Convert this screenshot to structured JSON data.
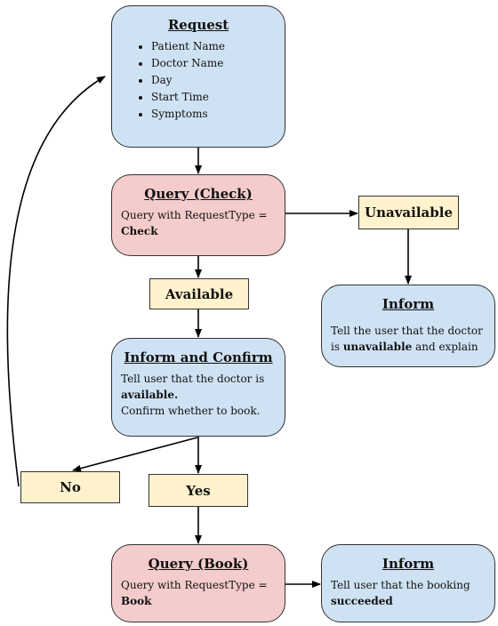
{
  "colors": {
    "process_blue": "#cfe2f3",
    "query_pink": "#f4cccc",
    "label_yellow": "#fff2cc",
    "stroke": "#000000"
  },
  "request": {
    "title": "Request",
    "items": [
      "Patient Name",
      "Doctor Name",
      "Day",
      "Start Time",
      "Symptoms"
    ]
  },
  "query_check": {
    "title": "Query (Check)",
    "text": "Query with RequestType =",
    "bold": "Check"
  },
  "unavailable": {
    "label": "Unavailable"
  },
  "available": {
    "label": "Available"
  },
  "inform_unavailable": {
    "title": "Inform",
    "text1": "Tell the user that the doctor",
    "text2_pre": "is ",
    "text2_bold": "unavailable",
    "text2_post": " and explain"
  },
  "inform_confirm": {
    "title": "Inform and Confirm",
    "text1": "Tell user that the doctor  is",
    "bold": "available.",
    "text3": "Confirm whether to book."
  },
  "no": {
    "label": "No"
  },
  "yes": {
    "label": "Yes"
  },
  "query_book": {
    "title": "Query (Book)",
    "text": "Query with RequestType =",
    "bold": "Book"
  },
  "inform_success": {
    "title": "Inform",
    "text": "Tell user that the booking",
    "bold": "succeeded"
  }
}
